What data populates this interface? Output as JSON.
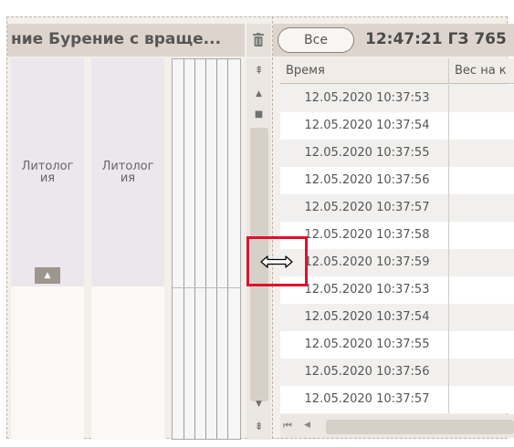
{
  "left_panel": {
    "title": "ние Бурение с враще...",
    "columns": [
      {
        "label": "Литолог\nия"
      },
      {
        "label": "Литолог\nия"
      }
    ],
    "expand_glyph": "▲",
    "trash_glyph": "🗑",
    "scroll_top_glyph": "⇞",
    "scroll_up_glyph": "▲",
    "scroll_down_glyph": "▼",
    "scroll_bottom_glyph": "⇟",
    "scroll_square_glyph": "■"
  },
  "right_panel": {
    "filter_button": "Все",
    "title": "12:47:21 ГЗ 765",
    "headers": [
      "Время",
      "Вес на к"
    ],
    "rows": [
      "12.05.2020 10:37:53",
      "12.05.2020 10:37:54",
      "12.05.2020 10:37:55",
      "12.05.2020 10:37:56",
      "12.05.2020 10:37:57",
      "12.05.2020 10:37:58",
      "12.05.2020 10:37:59",
      "12.05.2020 10:37:53",
      "12.05.2020 10:37:54",
      "12.05.2020 10:37:55",
      "12.05.2020 10:37:56",
      "12.05.2020 10:37:57"
    ],
    "hscroll_first_glyph": "⏮",
    "hscroll_prev_glyph": "◀"
  },
  "colors": {
    "header_bg": "#ddd5cd",
    "row_alt": "#f1f0ef",
    "highlight": "#e0102a"
  }
}
